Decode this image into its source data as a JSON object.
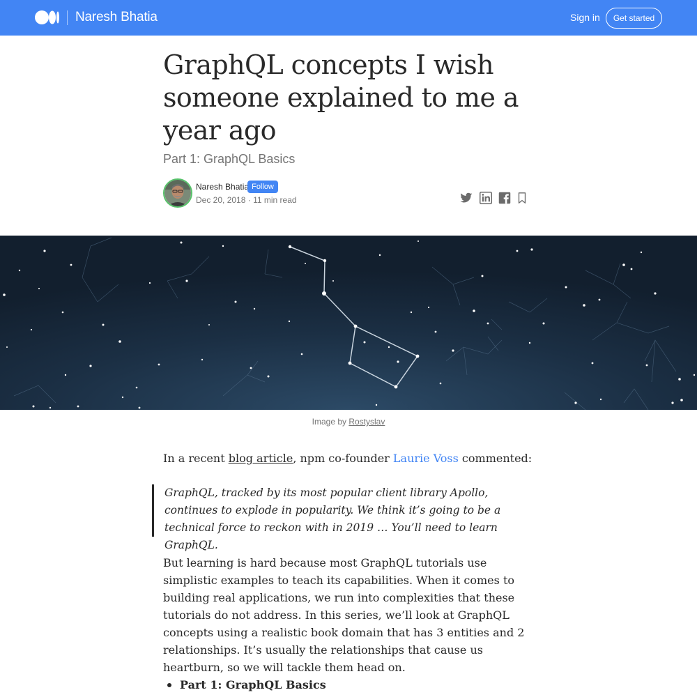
{
  "header": {
    "publication_name": "Naresh Bhatia",
    "signin_label": "Sign in",
    "get_started_label": "Get started",
    "background_color": "#4285f4"
  },
  "article": {
    "title": "GraphQL concepts I wish someone explained to me a year ago",
    "subtitle": "Part 1: GraphQL Basics",
    "author": {
      "name": "Naresh Bhatia",
      "follow_label": "Follow",
      "date": "Dec 20, 2018",
      "separator": " · ",
      "read_time": "11 min read"
    },
    "share_icons": [
      "twitter-icon",
      "linkedin-icon",
      "facebook-icon",
      "bookmark-icon"
    ],
    "hero_caption": {
      "prefix": "Image by ",
      "link_text": "Rostyslav"
    },
    "intro": {
      "part1": "In a recent ",
      "link1": "blog article",
      "part2": ", npm co-founder ",
      "link2": "Laurie Voss",
      "part3": " commented:"
    },
    "quote": "GraphQL, tracked by its most popular client library Apollo, continues to explode in popularity. We think it’s going to be a technical force to reckon with in 2019 … You’ll need to learn GraphQL.",
    "paragraph2": "But learning is hard because most GraphQL tutorials use simplistic examples to teach its capabilities. When it comes to building real applications, we run into complexities that these tutorials do not address. In this series, we’ll look at GraphQL concepts using a realistic book domain that has 3 entities and 2 relationships. It’s usually the relationships that cause us heartburn, so we will tackle them head on.",
    "list_items": [
      "Part 1: GraphQL Basics"
    ],
    "link_color": "#4285f4",
    "follow_color": "#4285f4",
    "avatar_ring_color": "#57c26a"
  }
}
